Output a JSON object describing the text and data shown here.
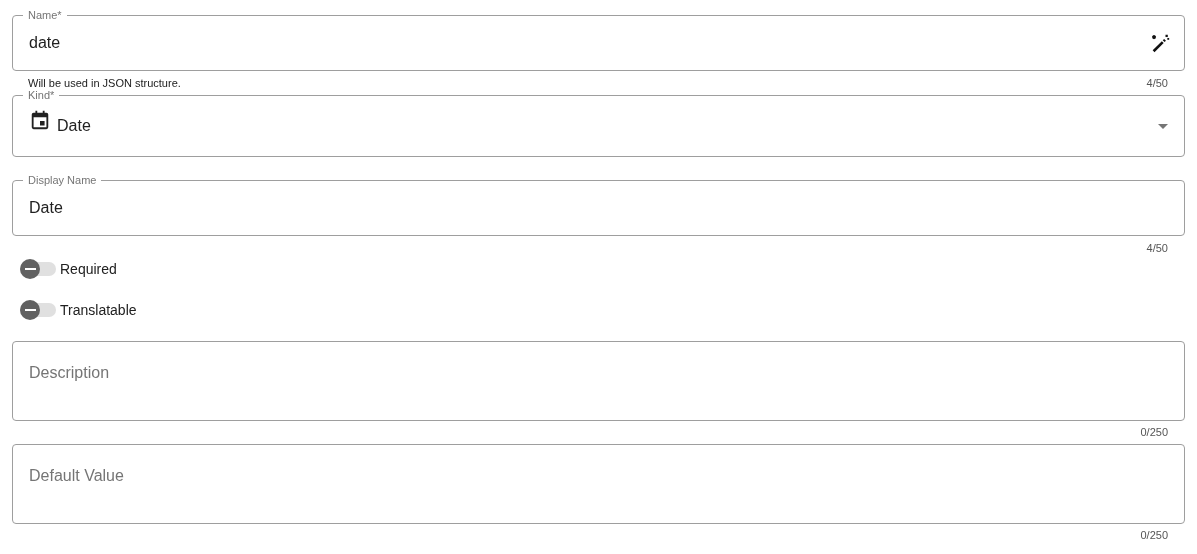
{
  "fields": [
    {
      "kind": "text",
      "label": "Name*",
      "value": "date",
      "action": true,
      "hint": "Will be used in JSON structure.",
      "counter": "4/50"
    },
    {
      "kind": "select",
      "label": "Kind*",
      "value": "Date"
    },
    {
      "kind": "text",
      "label": "Display Name",
      "value": "Date",
      "counter": "4/50"
    },
    {
      "kind": "toggle",
      "label": "Required",
      "on": false
    },
    {
      "kind": "toggle",
      "label": "Translatable",
      "on": false
    },
    {
      "kind": "textarea",
      "placeholder": "Description",
      "counter": "0/250"
    },
    {
      "kind": "textarea",
      "placeholder": "Default Value",
      "counter": "0/250"
    }
  ]
}
